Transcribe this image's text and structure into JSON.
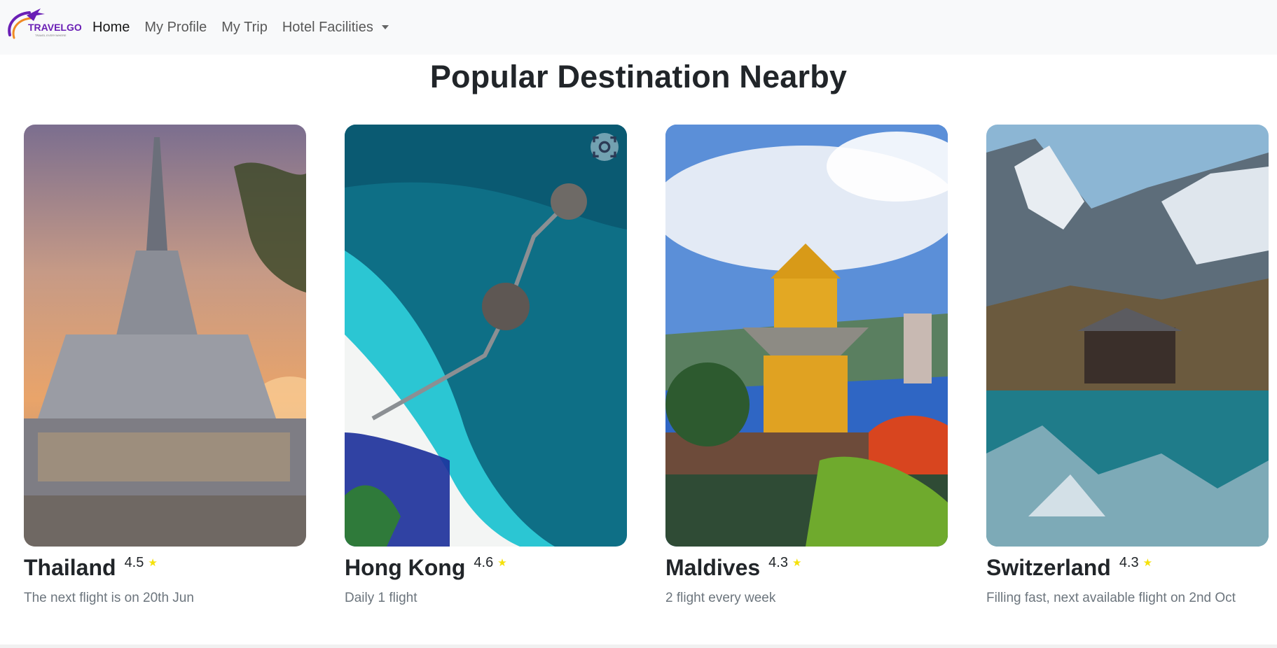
{
  "brand": {
    "name": "TRAVELGO",
    "tagline": "TRAVEL EVERYWHERE",
    "colors": {
      "purple": "#6a1fb5",
      "orange": "#f08a24"
    }
  },
  "nav": {
    "items": [
      {
        "label": "Home",
        "active": true
      },
      {
        "label": "My Profile",
        "active": false
      },
      {
        "label": "My Trip",
        "active": false
      },
      {
        "label": "Hotel Facilities",
        "active": false,
        "dropdown": true
      }
    ]
  },
  "section": {
    "title": "Popular Destination Nearby"
  },
  "destinations": [
    {
      "name": "Thailand",
      "rating": "4.5",
      "note": "The next flight is on 20th Jun"
    },
    {
      "name": "Hong Kong",
      "rating": "4.6",
      "note": "Daily 1 flight"
    },
    {
      "name": "Maldives",
      "rating": "4.3",
      "note": "2 flight every week"
    },
    {
      "name": "Switzerland",
      "rating": "4.3",
      "note": "Filling fast, next available flight on 2nd Oct"
    }
  ],
  "icons": {
    "star": "★",
    "lens": "visual-search-icon",
    "caret": "chevron-down-icon"
  },
  "colors": {
    "star": "#f5e10a",
    "muted_text": "#6c757d",
    "navbar_bg": "#f8f9fa"
  }
}
